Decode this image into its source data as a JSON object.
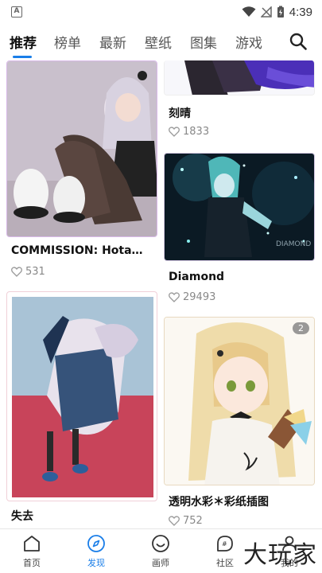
{
  "status_bar": {
    "time": "4:39",
    "icons": [
      "notification-a-icon",
      "wifi-icon",
      "signal-icon",
      "battery-icon"
    ]
  },
  "tabs": [
    {
      "label": "推荐",
      "active": true
    },
    {
      "label": "榜单"
    },
    {
      "label": "最新"
    },
    {
      "label": "壁纸"
    },
    {
      "label": "图集"
    },
    {
      "label": "游戏"
    }
  ],
  "feed": {
    "left": [
      {
        "title": "COMMISSION: Hota…",
        "likes": "531"
      },
      {
        "title": "失去",
        "likes": ""
      }
    ],
    "right": [
      {
        "title": "刻晴",
        "likes": "1833"
      },
      {
        "title": "Diamond",
        "likes": "29493"
      },
      {
        "title": "透明水彩＊彩纸插图",
        "likes": "752",
        "badge": "2"
      }
    ]
  },
  "bottom_nav": [
    {
      "label": "首页",
      "icon": "home-icon"
    },
    {
      "label": "发现",
      "icon": "compass-icon",
      "active": true
    },
    {
      "label": "画师",
      "icon": "smile-icon"
    },
    {
      "label": "社区",
      "icon": "community-icon"
    },
    {
      "label": "我的",
      "icon": "profile-icon"
    }
  ],
  "watermark": "大玩家",
  "colors": {
    "accent": "#1a7ee8",
    "text": "#111111",
    "muted": "#888888"
  }
}
